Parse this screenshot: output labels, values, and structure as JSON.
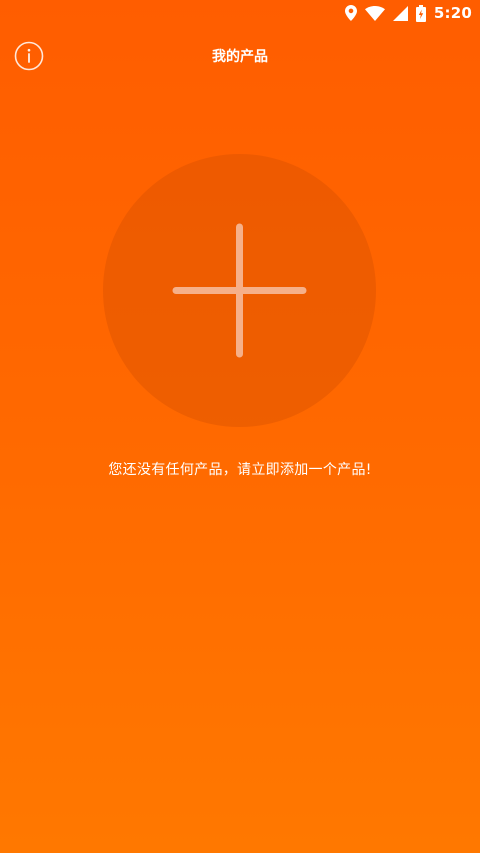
{
  "status_bar": {
    "time": "5:20",
    "icons": [
      "location-icon",
      "wifi-icon",
      "signal-icon",
      "battery-charging-icon"
    ]
  },
  "header": {
    "title": "我的产品",
    "info_icon": "info-icon"
  },
  "main": {
    "add_icon": "plus-icon",
    "empty_message": "您还没有任何产品，请立即添加一个产品!"
  },
  "colors": {
    "background_top": "#ff5d00",
    "background_bottom": "#ff7800",
    "circle": "#e85a00",
    "plus": "#f6b089",
    "text": "#ffffff"
  }
}
